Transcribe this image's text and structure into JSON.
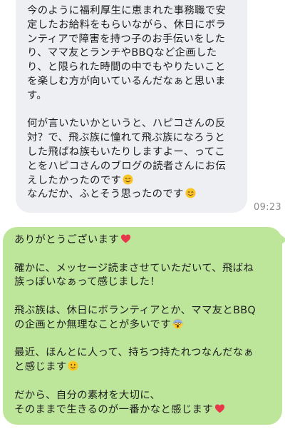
{
  "chat": {
    "incoming": {
      "lines_a": [
        "今のように福利厚生に恵まれた事務職で安",
        "定したお給料をもらいながら、休日にボラ",
        "ンティアで障害を持つ子のお手伝いをした",
        "り、ママ友とランチやBBQなど企画した",
        "り、と限られた時間の中でもやりたいこと",
        "を楽しむ方が向いているんだなぁと思いま",
        "す。"
      ],
      "lines_b": [
        "何が言いたいかというと、ハピコさんの反",
        "対？で、飛ぶ族に憧れて飛ぶ族になろうと",
        "した飛ばね族もいたりしますよー、ってこ",
        "とをハピコさんのブログの読者さんにお伝"
      ],
      "line_c": "えしたかったのです",
      "line_d": "なんだか、ふとそう思ったのです",
      "timestamp": "09:23"
    },
    "outgoing": {
      "p1": "ありがとうございます",
      "p2": [
        "確かに、メッセージ読まさせていただいて、飛ばね",
        "族っぽいなぁって感じました！"
      ],
      "p3a": "飛ぶ族は、休日にボランティアとか、ママ友とBBQ",
      "p3b": "の企画とか無理なことが多いです",
      "p4a": "最近、ほんとに人って、持ちつ持たれつなんだなぁ",
      "p4b": "と感じます",
      "p5a": "だから、自分の素材を大切に、",
      "p5b": "そのままで生きるのが一番かなと感じます"
    }
  },
  "icons": {
    "blush": "smiling-face-with-smiling-eyes-icon",
    "heart": "red-heart-icon",
    "scream": "face-screaming-icon",
    "smile": "slightly-smiling-face-icon"
  },
  "colors": {
    "incoming_bubble": "#eeeff2",
    "outgoing_bubble": "#bde69b",
    "timestamp": "#8c8c8c",
    "heart": "#e8374a"
  }
}
